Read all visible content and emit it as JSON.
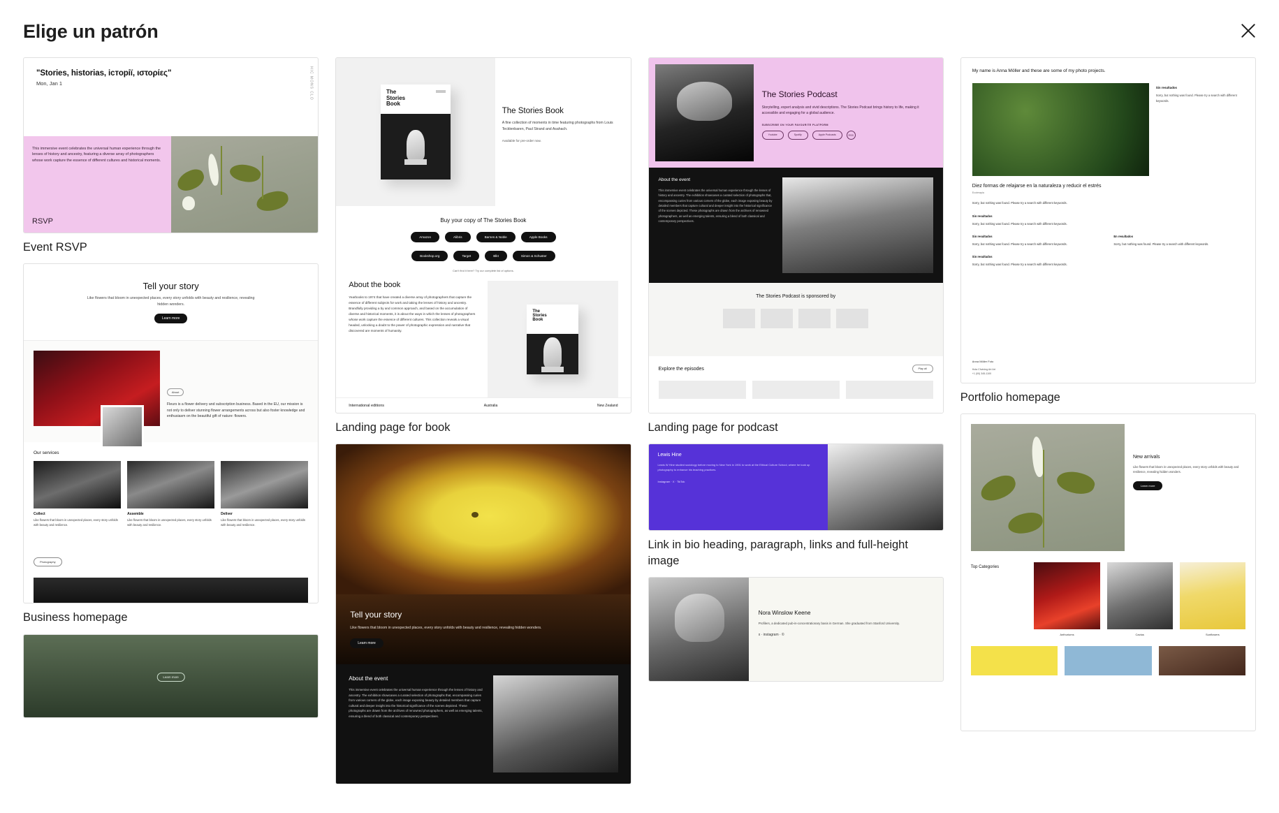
{
  "header": {
    "title": "Elige un patrón",
    "close_label": "Cerrar",
    "close_icon": "close-icon"
  },
  "patterns": [
    {
      "id": "event-rsvp",
      "caption": "Event RSVP",
      "preview": {
        "title": "\"Stories, historias, історії, ιστορίες\"",
        "date": "Mon, Jan 1",
        "vertical_label": "HIC MONS CLO",
        "body": "This immersive event celebrates the universal human experience through the lenses of history and ancestry, featuring a diverse array of photographers whose work capture the essence of different cultures and historical moments.",
        "cta": "RSVP"
      }
    },
    {
      "id": "business-homepage",
      "caption": "Business homepage",
      "preview": {
        "hero_title": "Tell your story",
        "hero_body": "Like flowers that bloom in unexpected places, every story unfolds with beauty and resilience, revealing hidden wonders.",
        "hero_button": "Learn more",
        "badge": "About",
        "about_body": "Fleurs is a flower delivery and subscription business. Based in the EU, our mission is not only to deliver stunning flower arrangements across but also foster knowledge and enthusiasm on the beautiful gift of nature: flowers.",
        "services_title": "Our services",
        "services": [
          {
            "title": "Collect",
            "body": "Like flowers that bloom in unexpected places, every story unfolds with beauty and resilience."
          },
          {
            "title": "Assemble",
            "body": "Like flowers that bloom in unexpected places, every story unfolds with beauty and resilience."
          },
          {
            "title": "Deliver",
            "body": "Like flowers that bloom in unexpected places, every story unfolds with beauty and resilience."
          }
        ],
        "footer_pill": "Photography"
      }
    },
    {
      "id": "landing-page-book",
      "caption": "Landing page for book",
      "preview": {
        "cover_title": "The\nStories\nBook",
        "heading": "The Stories Book",
        "body": "A fine collection of moments in time featuring photographs from Louis Tecklenbaren, Paul Strand and Asahach.",
        "note": "Available for pre-order now.",
        "buy_heading": "Buy your copy of The Stories Book",
        "retailers": [
          "Amazon",
          "Alibris",
          "Barnes & Noble",
          "Apple Books",
          "Bookshop.org",
          "Target",
          "Blkt",
          "Simon & Schuster"
        ],
        "tiny_note": "Can't find it here? Try our complete list of options.",
        "about_heading": "About the book",
        "about_body": "Yearbooks to 1974 that have created a diverse array of photographers that capture the essence of different subjects for work and taking the lenses of history and ancestry. Brandfully providing a by and common approach, and based on the accumulation of diverse and historical moments, it is about the ways in which the lenses of photographers whose work capture the essence of different cultures. This collection reveals a visual headed, unlocking a doubt to the power of photographic expression and narrative that discovered are moments of humanity.",
        "editions_label": "International editions",
        "editions": [
          "Australia",
          "New Zealand"
        ]
      }
    },
    {
      "id": "tell-your-story-flower",
      "caption": "",
      "preview": {
        "heading": "Tell your story",
        "body": "Like flowers that bloom in unexpected places, every story unfolds with beauty and resilience, revealing hidden wonders.",
        "button": "Learn more",
        "about_heading": "About the event",
        "about_body": "This immersive event celebrates the universal human experience through the lenses of history and ancestry. The exhibition showcases a curated selection of photographs that, encompassing curies from various corners of the globe, each image exposing beauty by detailed members that capture cultural and deeper insight into the historical significance of the scenes depicted. These photographs are drawn from the archives of renowned photographers, as well as emerging talents, ensuring a blend of both classical and contemporary perspectives."
      }
    },
    {
      "id": "landing-page-podcast",
      "caption": "Landing page for podcast",
      "preview": {
        "heading": "The Stories Podcast",
        "body": "Storytelling, expert analysis and vivid descriptions. The Stories Podcast brings history to life, making it accessible and engaging for a global audience.",
        "subscribe_label": "SUBSCRIBE ON YOUR FAVOURITE PLATFORM",
        "platforms": [
          "Youtube",
          "Spotify",
          "Apple Podcasts",
          "RSS"
        ],
        "about_heading": "About the event",
        "about_body": "This immersive event celebrates the universal human experience through the lenses of history and ancestry. The exhibition showcases a curated selection of photographs that, encompassing curies from various corners of the globe, each image exposing beauty by detailed members that capture cultural and deeper insight into the historical significance of the scenes depicted. These photographs are drawn from the archives of renowned photographers, as well as emerging talents, ensuring a blend of both classical and contemporary perspectives.",
        "sponsor_heading": "The Stories Podcast is sponsored by",
        "explore_heading": "Explore the episodes",
        "explore_button": "Play all"
      }
    },
    {
      "id": "link-in-bio",
      "caption": "Link in bio heading, paragraph, links and full-height image",
      "preview": {
        "heading": "Lewis Hine",
        "body": "Lewis W Hine studied sociology before moving to New York in 1901 to work at the Ethical Culture School, where he took up photography to enhance his teaching practices.",
        "links_label": "Instagram · X · TikTok"
      }
    },
    {
      "id": "nora-winslow-keene",
      "caption": "",
      "preview": {
        "heading": "Nora Winslow Keene",
        "body": "Profilers, a dedicated pub-in-concentrationary basis in German. She graduated from Stanford University.",
        "social": "x · instagram · ©"
      }
    },
    {
      "id": "portfolio-homepage",
      "caption": "Portfolio homepage",
      "preview": {
        "intro": "My name is Anna Möller and these are some of my photo projects.",
        "side_heading": "Sin resultados",
        "side_body": "Sorry, but nothing was found. Please try a search with different keywords.",
        "article_title": "Diez formas de relajarse en la naturaleza y reducir el estrés",
        "article_sub": "Ecoterapia",
        "article_body": "Sorry, but nothing was found. Please try a search with different keywords.",
        "columns": [
          {
            "heading": "Sin resultados",
            "body": "Sorry, but nothing was found. Please try a search with different keywords."
          },
          {
            "heading": "Sin resultados",
            "body": "Sorry, but nothing was found. Please try a search with different keywords."
          }
        ],
        "columns2": [
          {
            "heading": "Sin resultados",
            "body": "Sorry, but nothing was found. Please try a search with different keywords."
          }
        ],
        "footer_line1": "Anna Möller Foto",
        "footer_line2": "Hola Chvining Art Art\n+1 (00) 345-1100"
      }
    },
    {
      "id": "new-arrivals",
      "caption": "",
      "preview": {
        "heading": "New arrivals",
        "body": "Like flowers that bloom in unexpected places, every story unfolds with beauty and resilience, revealing hidden wonders.",
        "button": "Learn more",
        "categories_label": "Top Categories",
        "categories": [
          "Anthuriums",
          "Cactus",
          "Sunflowers"
        ]
      }
    }
  ]
}
